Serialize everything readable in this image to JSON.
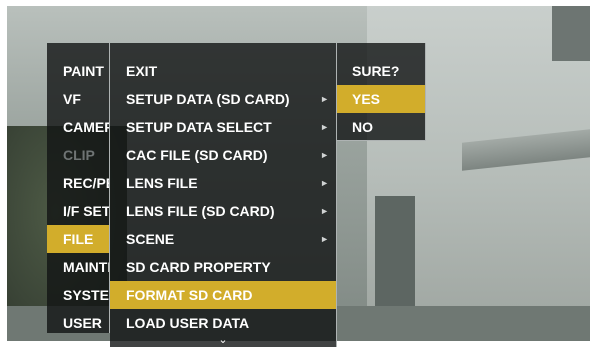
{
  "menu": {
    "main": [
      {
        "label": "PAINT"
      },
      {
        "label": "VF"
      },
      {
        "label": "CAMERA"
      },
      {
        "label": "CLIP"
      },
      {
        "label": "REC/PB"
      },
      {
        "label": "I/F SETUP"
      },
      {
        "label": "FILE"
      },
      {
        "label": "MAINTENANCE"
      },
      {
        "label": "SYSTEM"
      },
      {
        "label": "USER"
      }
    ],
    "file": [
      {
        "label": "EXIT"
      },
      {
        "label": "SETUP DATA (SD CARD)"
      },
      {
        "label": "SETUP DATA SELECT"
      },
      {
        "label": "CAC FILE (SD CARD)"
      },
      {
        "label": "LENS FILE"
      },
      {
        "label": "LENS FILE (SD CARD)"
      },
      {
        "label": "SCENE"
      },
      {
        "label": "SD CARD PROPERTY"
      },
      {
        "label": "FORMAT SD CARD"
      },
      {
        "label": "LOAD USER DATA"
      }
    ],
    "confirm": [
      {
        "label": "SURE?"
      },
      {
        "label": "YES"
      },
      {
        "label": "NO"
      }
    ],
    "submenu_arrow": "►",
    "more_indicator": "⌄"
  }
}
